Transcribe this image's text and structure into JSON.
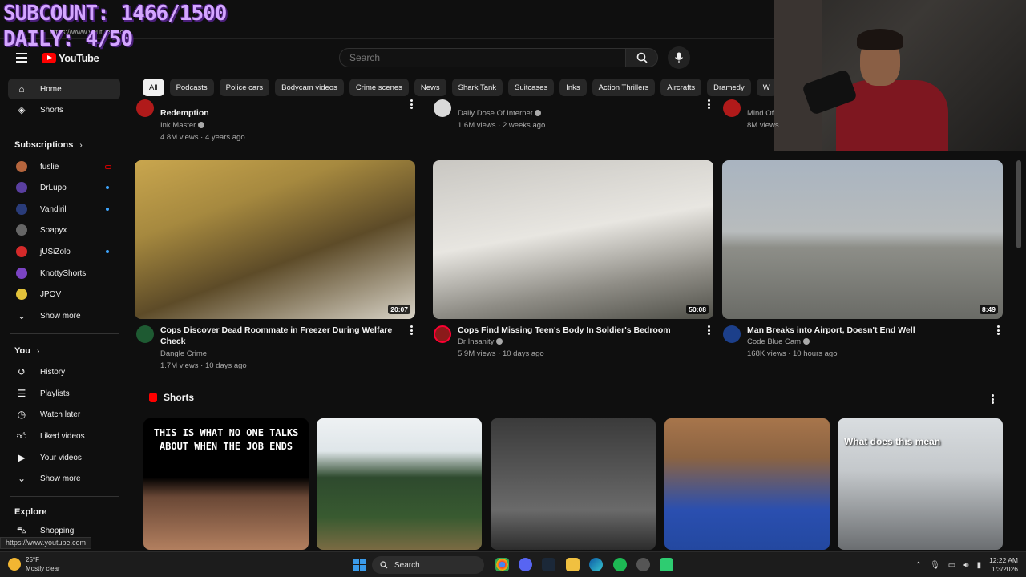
{
  "overlay": {
    "subcount": "SUBCOUNT: 1466/1500",
    "daily": "DAILY: 4/50"
  },
  "browser": {
    "url": "https://www.youtube.com"
  },
  "header": {
    "logo": "YouTube",
    "search_placeholder": "Search"
  },
  "sidebar": {
    "top": [
      {
        "label": "Home",
        "icon": "home-icon"
      },
      {
        "label": "Shorts",
        "icon": "shorts-icon"
      }
    ],
    "subscriptions_heading": "Subscriptions",
    "subscriptions": [
      {
        "label": "fuslie",
        "color": "#b5653d"
      },
      {
        "label": "DrLupo",
        "color": "#5a3fa0"
      },
      {
        "label": "Vandiril",
        "color": "#2a3c7a"
      },
      {
        "label": "Soapyx",
        "color": "#666666"
      },
      {
        "label": "jUSiZolo",
        "color": "#d42a2a"
      },
      {
        "label": "KnottyShorts",
        "color": "#7b44c4"
      },
      {
        "label": "JPOV",
        "color": "#e2c23a"
      },
      {
        "label": "Show more",
        "icon": "chevron-down-icon"
      }
    ],
    "you_heading": "You",
    "you": [
      {
        "label": "History",
        "icon": "history-icon"
      },
      {
        "label": "Playlists",
        "icon": "playlists-icon"
      },
      {
        "label": "Watch later",
        "icon": "watch-later-icon"
      },
      {
        "label": "Liked videos",
        "icon": "like-icon"
      },
      {
        "label": "Your videos",
        "icon": "your-videos-icon"
      },
      {
        "label": "Show more",
        "icon": "chevron-down-icon"
      }
    ],
    "explore_heading": "Explore",
    "explore": [
      {
        "label": "Shopping",
        "icon": "shopping-icon"
      }
    ]
  },
  "chips": [
    "All",
    "Podcasts",
    "Police cars",
    "Bodycam videos",
    "Crime scenes",
    "News",
    "Shark Tank",
    "Suitcases",
    "Inks",
    "Action Thrillers",
    "Aircrafts",
    "Dramedy",
    "W"
  ],
  "partial_row": [
    {
      "title_line2": "Redemption",
      "channel": "Ink Master",
      "meta": "4.8M views · 4 years ago"
    },
    {
      "channel": "Daily Dose Of Internet",
      "meta": "1.6M views · 2 weeks ago"
    },
    {
      "channel": "Mind Of",
      "meta": "8M views"
    }
  ],
  "videos": [
    {
      "title": "Cops Discover Dead Roommate in Freezer During Welfare Check",
      "channel": "Dangle Crime",
      "meta": "1.7M views · 10 days ago",
      "duration": "20:07"
    },
    {
      "title": "Cops Find Missing Teen's Body In Soldier's Bedroom",
      "channel": "Dr Insanity",
      "meta": "5.9M views · 10 days ago",
      "duration": "50:08"
    },
    {
      "title": "Man Breaks into Airport, Doesn't End Well",
      "channel": "Code Blue Cam",
      "meta": "168K views · 10 hours ago",
      "duration": "8:49"
    }
  ],
  "shorts": {
    "heading": "Shorts",
    "items": [
      {
        "caption": "THIS IS WHAT NO ONE TALKS ABOUT WHEN THE JOB ENDS"
      },
      {
        "caption": ""
      },
      {
        "caption": ""
      },
      {
        "caption": ""
      },
      {
        "caption": "What does this mean"
      }
    ]
  },
  "status_link": "https://www.youtube.com",
  "taskbar": {
    "weather_temp": "25°F",
    "weather_desc": "Mostly clear",
    "search": "Search",
    "time": "12:22 AM",
    "date": "1/3/2026"
  },
  "colors": {
    "accent": "#ff0000",
    "background": "#0f0f0f",
    "chip_selected": "#f1f1f1"
  }
}
